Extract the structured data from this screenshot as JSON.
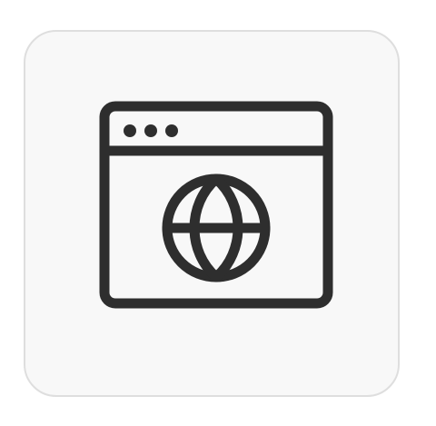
{
  "icon": {
    "name": "browser-globe-icon",
    "stroke_color": "#2e2e2e",
    "tile_background": "#f8f8f8",
    "tile_border": "#dedede"
  }
}
